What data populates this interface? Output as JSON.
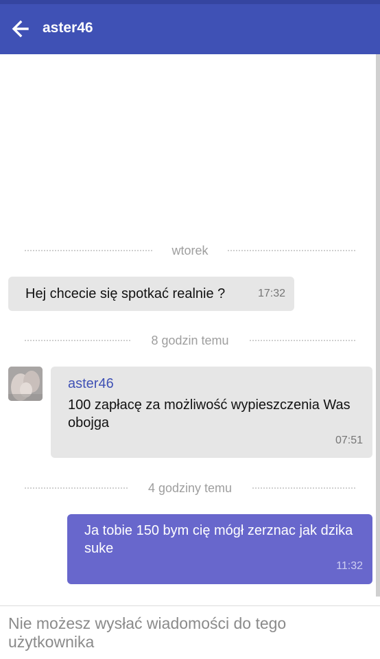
{
  "header": {
    "title": "aster46",
    "back_icon": "arrow-left-icon",
    "background": "#3f51b5"
  },
  "separators": [
    {
      "label": "wtorek"
    },
    {
      "label": "8 godzin temu"
    },
    {
      "label": "4 godziny temu"
    }
  ],
  "messages": [
    {
      "direction": "outgoing-left",
      "text": "Hej chcecie się spotkać realnie ?",
      "time": "17:32"
    },
    {
      "direction": "incoming",
      "sender": "aster46",
      "text": "100 zapłacę za możliwość wypieszczenia Was obojga",
      "time": "07:51"
    },
    {
      "direction": "outgoing",
      "text": "Ja tobie 150 bym cię mógł zerznac jak dzika suke",
      "time": "11:32",
      "color": "#6867cc"
    }
  ],
  "composer": {
    "notice": "Nie możesz wysłać wiadomości do tego użytkownika"
  }
}
